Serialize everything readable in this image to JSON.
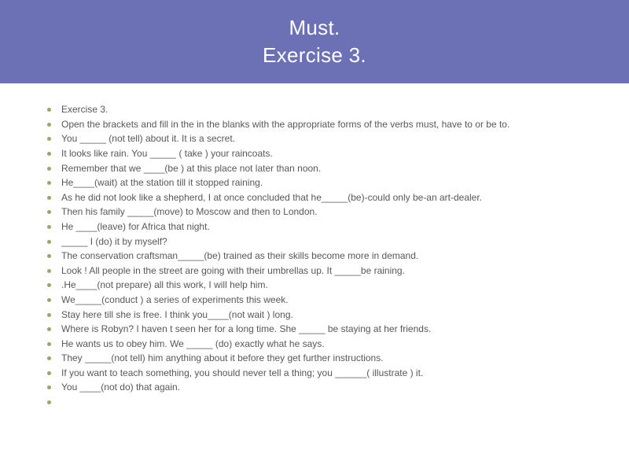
{
  "header": {
    "line1": "Must.",
    "line2": "Exercise 3."
  },
  "items": [
    "Exercise 3.",
    "Open the brackets and fill in the in the blanks with the appropriate forms of the verbs must, have to or be to.",
    "You _____ (not tell) about it. It is a secret.",
    " It looks like rain. You _____ ( take ) your raincoats.",
    " Remember that we ____(be ) at this place not later than noon.",
    " He____(wait) at the station till it stopped raining.",
    " As he did not look like a shepherd, I at once concluded that he_____(be)-could only be-an art-dealer.",
    "Then his family _____(move) to Moscow and then to London.",
    " He ____(leave) for Africa that night.",
    " _____ I (do) it by myself?",
    " The conservation craftsman_____(be) trained as their skills become more in demand.",
    " Look !  All people in the street are going with their umbrellas up. It _____be raining.",
    ".He____(not prepare) all this work, I will help him.",
    " We_____(conduct ) a series of experiments this week.",
    " Stay here till she is free. I think you____(not wait )   long.",
    " Where is Robyn? I haven t seen her for a long time. She _____  be staying at her friends.",
    " He wants us to obey him. We _____ (do) exactly what he says.",
    " They _____(not tell) him anything about it before they get further instructions.",
    "If you want to teach something, you should never tell a thing; you ______( illustrate ) it.",
    " You ____(not do) that again.",
    ""
  ]
}
